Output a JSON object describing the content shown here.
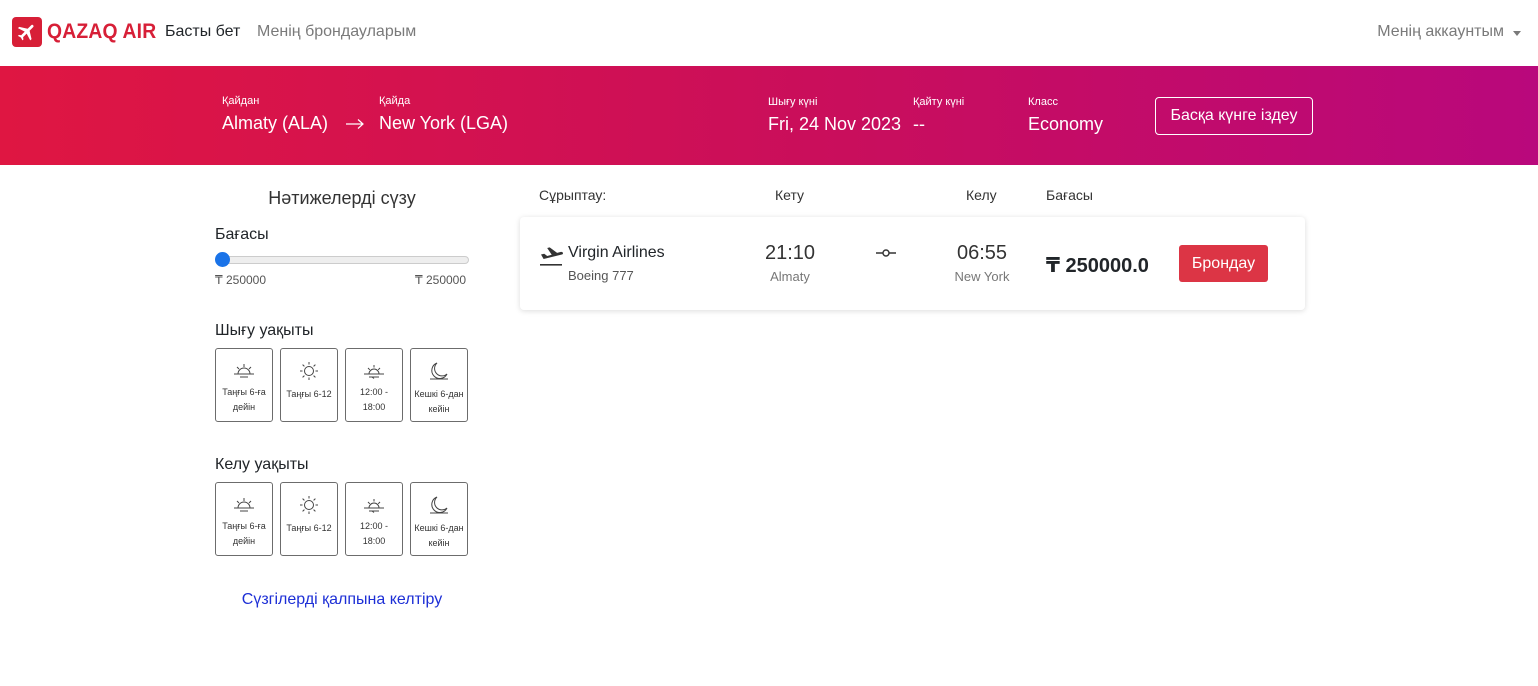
{
  "brand": {
    "name": "QAZAQ AIR",
    "color": "#d71f37",
    "icon": "airplane-icon"
  },
  "nav": {
    "home": "Басты бет",
    "bookings": "Менің брондауларым",
    "account": "Менің аккаунтым"
  },
  "search": {
    "from_label": "Қайдан",
    "from_value": "Almaty (ALA)",
    "to_label": "Қайда",
    "to_value": "New York (LGA)",
    "departure_label": "Шығу күні",
    "departure_value": "Fri, 24 Nov 2023",
    "return_label": "Қайту күні",
    "return_value": "--",
    "class_label": "Класс",
    "class_value": "Economy",
    "other_date_button": "Басқа күнге іздеу"
  },
  "filters": {
    "title": "Нәтижелерді сүзу",
    "price_title": "Бағасы",
    "price_min": "₸ 250000",
    "price_max": "₸ 250000",
    "price_slider_position": 0,
    "departure_time_title": "Шығу уақыты",
    "arrival_time_title": "Келу уақыты",
    "time_slots": [
      {
        "label": "Таңғы 6-ға дейін",
        "icon": "sunrise-icon"
      },
      {
        "label": "Таңғы 6-12",
        "icon": "sun-icon"
      },
      {
        "label": "12:00 - 18:00",
        "icon": "sunset-icon"
      },
      {
        "label": "Кешкі 6-дан кейін",
        "icon": "moon-icon"
      }
    ],
    "reset": "Сүзгілерді қалпына келтіру"
  },
  "results": {
    "headers": {
      "sort": "Сұрыптау:",
      "departure": "Кету",
      "arrival": "Келу",
      "price": "Бағасы"
    },
    "flights": [
      {
        "airline": "Virgin Airlines",
        "aircraft": "Boeing 777",
        "dep_time": "21:10",
        "dep_city": "Almaty",
        "arr_time": "06:55",
        "arr_city": "New York",
        "price": "₸ 250000.0",
        "book_label": "Брондау"
      }
    ]
  },
  "colors": {
    "banner_start": "#df1642",
    "banner_end": "#b9087c",
    "book_button": "#dc3545",
    "link": "#1d2fd6",
    "slider_thumb": "#1a73e8"
  }
}
